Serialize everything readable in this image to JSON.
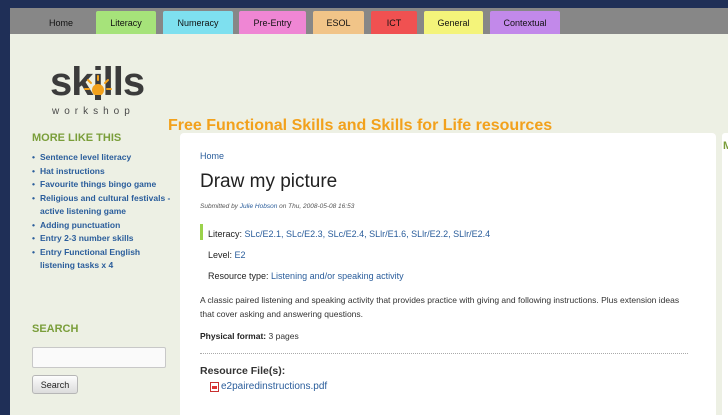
{
  "nav": {
    "tabs": [
      {
        "label": "Home",
        "color": "#878787"
      },
      {
        "label": "Literacy",
        "color": "#a6e37a"
      },
      {
        "label": "Numeracy",
        "color": "#7ee0ef"
      },
      {
        "label": "Pre-Entry",
        "color": "#ef86d4"
      },
      {
        "label": "ESOL",
        "color": "#f1c488"
      },
      {
        "label": "ICT",
        "color": "#f05151"
      },
      {
        "label": "General",
        "color": "#f4f47a"
      },
      {
        "label": "Contextual",
        "color": "#c289ea"
      }
    ]
  },
  "header": {
    "logo_main": "skills",
    "logo_sub": "workshop",
    "slogan": "Free Functional Skills and Skills for Life resources",
    "accent_color": "#f2a11c"
  },
  "sidebar": {
    "more_heading": "MORE LIKE THIS",
    "items": [
      "Sentence level literacy",
      "Hat instructions",
      "Favourite things bingo game",
      "Religious and cultural festivals - active listening game",
      "Adding punctuation",
      "Entry 2-3 number skills",
      "Entry Functional English listening tasks x 4"
    ],
    "search_heading": "SEARCH",
    "search_button": "Search",
    "right_initial": "M"
  },
  "main": {
    "breadcrumb": "Home",
    "title": "Draw my picture",
    "submitted_prefix": "Submitted by",
    "submitted_author": "Julie Hobson",
    "submitted_suffix": "on Thu, 2008-05-08 16:53",
    "literacy_label": "Literacy:",
    "literacy_values": "SLc/E2.1, SLc/E2.3, SLc/E2.4, SLlr/E1.6, SLlr/E2.2, SLlr/E2.4",
    "level_label": "Level:",
    "level_value": "E2",
    "resource_type_label": "Resource type:",
    "resource_type_value": "Listening and/or speaking activity",
    "description": "A classic paired listening and speaking activity that provides practice with giving and following instructions. Plus extension ideas that cover asking and answering questions.",
    "physical_label": "Physical format:",
    "physical_value": "3 pages",
    "files_heading": "Resource File(s):",
    "file_name": "e2pairedinstructions.pdf"
  }
}
